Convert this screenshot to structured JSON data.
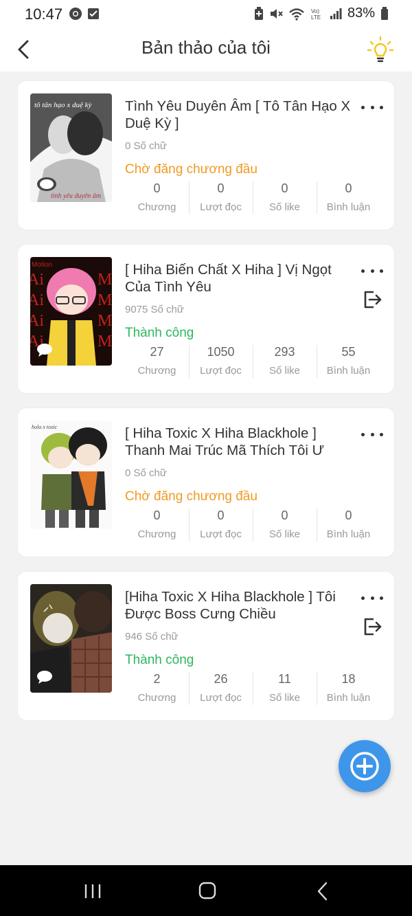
{
  "status_bar": {
    "time": "10:47",
    "battery": "83%",
    "left_icons": [
      "chrome-icon",
      "check-box-icon"
    ],
    "right_icons": [
      "battery-saver-icon",
      "mute-icon",
      "wifi-icon",
      "volte-icon",
      "signal-icon",
      "battery-icon"
    ]
  },
  "app_bar": {
    "title": "Bản thảo của tôi",
    "back_icon": "chevron-left-icon",
    "action_icon": "lightbulb-icon"
  },
  "colors": {
    "pending": "#f09a23",
    "success": "#2db75c",
    "fab": "#3e96ea",
    "bulb": "#f5c518"
  },
  "drafts": [
    {
      "title": "Tình Yêu Duyên Âm [ Tô Tân Hạo X Duệ Kỳ ]",
      "words": "0 Số chữ",
      "status": "Chờ đăng chương đầu",
      "status_type": "pending",
      "has_exit": false,
      "thumb_text_top": "tô tân hạo x duệ kỳ",
      "thumb_text_bottom": "tình yêu duyên âm",
      "stats": [
        {
          "value": "0",
          "label": "Chương"
        },
        {
          "value": "0",
          "label": "Lượt đọc"
        },
        {
          "value": "0",
          "label": "Số like"
        },
        {
          "value": "0",
          "label": "Bình luận"
        }
      ]
    },
    {
      "title": "[ Hiha Biến Chất X Hiha ] Vị Ngọt Của Tình Yêu",
      "words": "9075 Số chữ",
      "status": "Thành công",
      "status_type": "success",
      "has_exit": true,
      "thumb_text_top": "Motion",
      "stats": [
        {
          "value": "27",
          "label": "Chương"
        },
        {
          "value": "1050",
          "label": "Lượt đọc"
        },
        {
          "value": "293",
          "label": "Số like"
        },
        {
          "value": "55",
          "label": "Bình luận"
        }
      ]
    },
    {
      "title": "[ Hiha Toxic X Hiha Blackhole ] Thanh Mai Trúc Mã Thích Tôi Ư",
      "words": "0 Số chữ",
      "status": "Chờ đăng chương đầu",
      "status_type": "pending",
      "has_exit": false,
      "thumb_text_top": "hola x toxic",
      "stats": [
        {
          "value": "0",
          "label": "Chương"
        },
        {
          "value": "0",
          "label": "Lượt đọc"
        },
        {
          "value": "0",
          "label": "Số like"
        },
        {
          "value": "0",
          "label": "Bình luận"
        }
      ]
    },
    {
      "title": "[Hiha Toxic X Hiha Blackhole ] Tôi Được Boss Cưng Chiều",
      "words": "946 Số chữ",
      "status": "Thành công",
      "status_type": "success",
      "has_exit": true,
      "stats": [
        {
          "value": "2",
          "label": "Chương"
        },
        {
          "value": "26",
          "label": "Lượt đọc"
        },
        {
          "value": "11",
          "label": "Số like"
        },
        {
          "value": "18",
          "label": "Bình luận"
        }
      ]
    }
  ],
  "fab": {
    "icon": "plus-icon"
  },
  "nav_bar": {
    "icons": [
      "recents-icon",
      "home-icon",
      "back-icon"
    ]
  }
}
